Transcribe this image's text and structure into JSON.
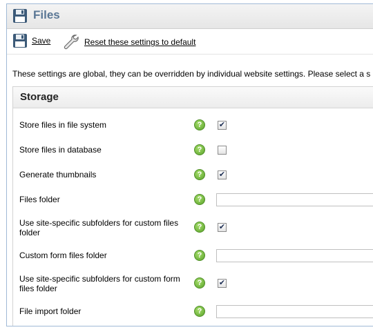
{
  "header": {
    "title": "Files",
    "icon": "floppy-disk-icon"
  },
  "toolbar": {
    "save_label": "Save",
    "reset_label": "Reset these settings to default"
  },
  "info_text": "These settings are global, they can be overridden by individual website settings. Please select a s",
  "panel": {
    "title": "Storage",
    "rows": [
      {
        "label": "Store files in file system",
        "control": "checkbox",
        "checked": true
      },
      {
        "label": "Store files in database",
        "control": "checkbox",
        "checked": false
      },
      {
        "label": "Generate thumbnails",
        "control": "checkbox",
        "checked": true
      },
      {
        "label": "Files folder",
        "control": "text",
        "value": ""
      },
      {
        "label": "Use site-specific subfolders for custom files folder",
        "control": "checkbox",
        "checked": true
      },
      {
        "label": "Custom form files folder",
        "control": "text",
        "value": ""
      },
      {
        "label": "Use site-specific subfolders for custom form files folder",
        "control": "checkbox",
        "checked": true
      },
      {
        "label": "File import folder",
        "control": "text",
        "value": ""
      }
    ]
  },
  "colors": {
    "title_text": "#5a7795",
    "help_icon": "#5aa32a",
    "frame_border": "#9fb9d6"
  }
}
